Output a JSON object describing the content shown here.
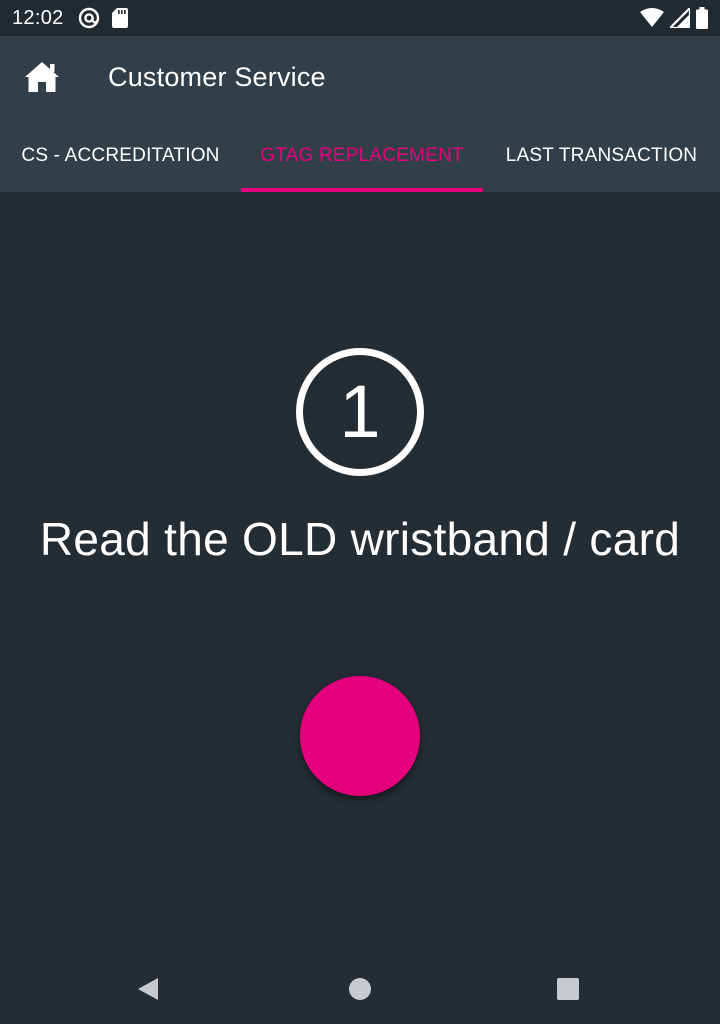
{
  "status_bar": {
    "time": "12:02",
    "left_icons": [
      "at-sign-icon",
      "sd-card-icon"
    ],
    "right_icons": [
      "wifi-icon",
      "signal-icon",
      "battery-icon"
    ]
  },
  "app_bar": {
    "title": "Customer Service",
    "home_icon": "home-icon"
  },
  "tabs": [
    {
      "label": "CS - ACCREDITATION",
      "selected": false
    },
    {
      "label": "GTAG REPLACEMENT",
      "selected": true
    },
    {
      "label": "LAST TRANSACTION",
      "selected": false
    }
  ],
  "content": {
    "step_number": "1",
    "instruction": "Read the OLD wristband / card"
  },
  "nav_bar": {
    "buttons": [
      "back-icon",
      "home-circle-icon",
      "recents-icon"
    ]
  },
  "colors": {
    "accent": "#e6007e",
    "app_bar_bg": "#333f48",
    "background": "#252d34",
    "status_bar_bg": "#212a31"
  }
}
